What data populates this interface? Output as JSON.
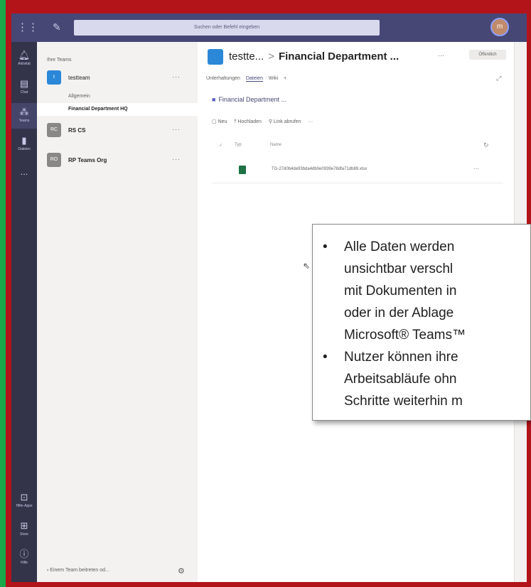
{
  "topbar": {
    "search_placeholder": "Suchen oder Befehl eingeben",
    "avatar_initials": "m"
  },
  "rail": {
    "items": [
      {
        "label": "Aktivität",
        "icon": "bell-icon"
      },
      {
        "label": "Chat",
        "icon": "chat-icon"
      },
      {
        "label": "Teams",
        "icon": "teams-icon"
      },
      {
        "label": "Dateien",
        "icon": "file-icon"
      },
      {
        "label": "...",
        "icon": "more-icon"
      },
      {
        "label": "Hilfe-Apps",
        "icon": "apps-icon"
      },
      {
        "label": "Store",
        "icon": "store-icon"
      },
      {
        "label": "Hilfe",
        "icon": "help-icon"
      }
    ]
  },
  "teams_panel": {
    "heading": "Ihre Teams",
    "teams": [
      {
        "name": "testteam",
        "tile": "t",
        "color": "#2b88d8"
      },
      {
        "name": "RS CS",
        "tile": "RC",
        "color": "#8a8886"
      },
      {
        "name": "RP Teams Org",
        "tile": "RO",
        "color": "#8a8886"
      }
    ],
    "channels": [
      "Allgemein",
      "Financial Department HQ"
    ],
    "join_text": "Einem Team beitreten od..."
  },
  "channel": {
    "team_short": "testte...",
    "separator": ">",
    "name": "Financial Department ...",
    "more": "···",
    "badge": "Öffentlich",
    "tabs": [
      "Unterhaltungen",
      "Dateien",
      "Wiki",
      "+"
    ],
    "files_title": "Financial Department ...",
    "commands": [
      "Neu",
      "Hochladen",
      "Link abrufen",
      "···"
    ],
    "columns": {
      "type": "Typ",
      "name": "Name"
    },
    "file": {
      "name": "TG-27d0b4de93bda4db0e0939e78dfa71db89.xlsx",
      "more": "···"
    }
  },
  "callout": {
    "bullet1_lines": [
      "Alle Daten werden",
      "unsichtbar verschl",
      "mit Dokumenten in",
      "oder in der Ablage",
      "Microsoft® Teams™"
    ],
    "bullet2_lines": [
      "Nutzer können ihre",
      "Arbeitsabläufe ohn",
      "Schritte weiterhin m"
    ]
  },
  "colors": {
    "frame_red": "#b3141a",
    "accent_green": "#19a84a",
    "teams_purple": "#464775"
  }
}
